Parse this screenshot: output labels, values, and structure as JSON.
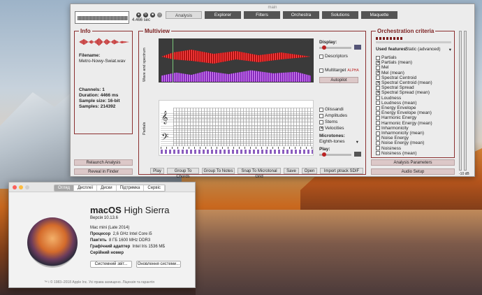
{
  "main_window": {
    "title": "main",
    "mini_duration": "4.466 sec",
    "tabs": [
      "Analysis",
      "Explorer",
      "Filters",
      "Orchestra",
      "Solutions",
      "Maquette"
    ],
    "active_tab": "Analysis"
  },
  "info": {
    "title": "Info",
    "filename_label": "Filename:",
    "filename": "Metro-Nowy-Swiat.wav",
    "channels": "Channels:  1",
    "duration": "Duration:  4466 ms",
    "sample_size": "Sample size:  16-bit",
    "samples": "Samples:  214392",
    "relaunch_button": "Relaunch Analysis",
    "reveal_button": "Reveal in Finder"
  },
  "multiview": {
    "title": "Multiview",
    "wave_label": "Wave and spectrum",
    "partials_label": "Partials",
    "display_label": "Display:",
    "descriptors": "Descriptors",
    "multitarget": "Multitarget",
    "alpha": "ALPHA",
    "autopilot": "Autopilot",
    "checkboxes": [
      {
        "label": "Glissandi",
        "checked": false
      },
      {
        "label": "Amplitudes",
        "checked": false
      },
      {
        "label": "Stems",
        "checked": false
      },
      {
        "label": "Velocities",
        "checked": true
      }
    ],
    "microtones_label": "Microtones:",
    "microtones_value": "Eighth-tones",
    "play_label": "Play:",
    "bottom_buttons": [
      "Play",
      "Group To Chords",
      "Group To Notes",
      "Snap To Microtonal Grid",
      "Save",
      "Open",
      "Import ptrack SDIF"
    ]
  },
  "orchestration": {
    "title": "Orchestration criteria",
    "used_features_label": "Used features:",
    "used_features_value": "Static (advanced)",
    "features": [
      {
        "label": "Partials",
        "checked": false
      },
      {
        "label": "Partials (mean)",
        "checked": true
      },
      {
        "label": "Mel",
        "checked": false
      },
      {
        "label": "Mel (mean)",
        "checked": true
      },
      {
        "label": "Spectral Centroid",
        "checked": false
      },
      {
        "label": "Spectral Centroid (mean)",
        "checked": true
      },
      {
        "label": "Spectral Spread",
        "checked": false
      },
      {
        "label": "Spectral Spread (mean)",
        "checked": true
      },
      {
        "label": "Loudness",
        "checked": false
      },
      {
        "label": "Loudness (mean)",
        "checked": false
      },
      {
        "label": "Energy Envelope",
        "checked": false
      },
      {
        "label": "Energy Envelope (mean)",
        "checked": false
      },
      {
        "label": "Harmonic Energy",
        "checked": false
      },
      {
        "label": "Harmonic Energy (mean)",
        "checked": false
      },
      {
        "label": "Inharmonicity",
        "checked": false
      },
      {
        "label": "Inharmonicity (mean)",
        "checked": false
      },
      {
        "label": "Noise Energy",
        "checked": false
      },
      {
        "label": "Noise Energy (mean)",
        "checked": false
      },
      {
        "label": "Noisiness",
        "checked": false
      },
      {
        "label": "Noisiness (mean)",
        "checked": false
      }
    ],
    "analysis_params_button": "Analysis Parameters",
    "audio_setup_button": "Audio Setup",
    "db_readout": "-10 dB"
  },
  "about": {
    "tabs": [
      "Огляд",
      "Дисплеї",
      "Диски",
      "Підтримка",
      "Сервіс"
    ],
    "active_tab": "Огляд",
    "os_name_bold": "macOS",
    "os_name_rest": "High Sierra",
    "version": "Версія 10.13.6",
    "model": "Mac mini (Late 2014)",
    "rows": [
      {
        "k": "Процесор",
        "v": "2,6 GHz Intel Core i5"
      },
      {
        "k": "Пам'ять",
        "v": "8 ГБ 1600 MHz DDR3"
      },
      {
        "k": "Графічний адаптер",
        "v": "Intel Iris 1536 МБ"
      },
      {
        "k": "Серійний номер",
        "v": ""
      }
    ],
    "system_report_button": "Системний звіт...",
    "software_update_button": "Оновлення системи...",
    "footer": "™ і © 1983–2018 Apple Inc. Усі права захищено. Ліцензія та гарантія"
  },
  "colors": {
    "accent": "#8b2f2f"
  }
}
